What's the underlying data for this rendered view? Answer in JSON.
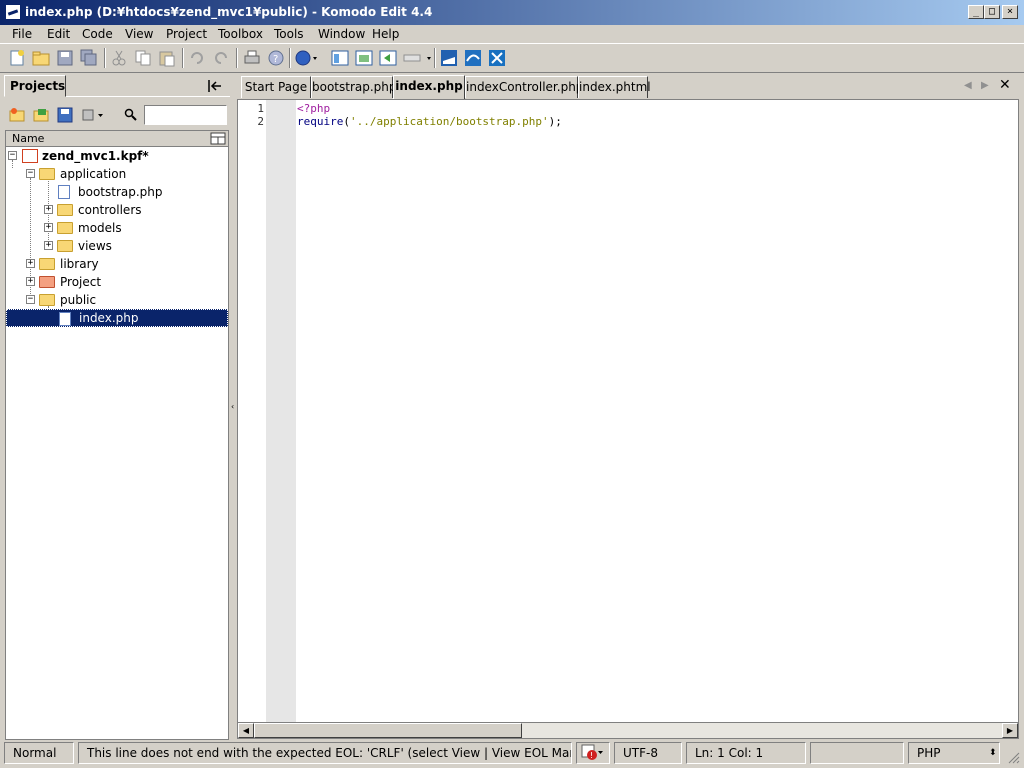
{
  "window": {
    "title": "index.php (D:¥htdocs¥zend_mvc1¥public) - Komodo Edit 4.4",
    "minimize": "_",
    "maximize": "□",
    "close": "×"
  },
  "menu": [
    "File",
    "Edit",
    "Code",
    "View",
    "Project",
    "Toolbox",
    "Tools",
    "Window",
    "Help"
  ],
  "projects_pane": {
    "tab_label": "Projects",
    "column_header": "Name",
    "tree": [
      {
        "label": "zend_mvc1.kpf*",
        "bold": true
      },
      {
        "label": "application"
      },
      {
        "label": "bootstrap.php"
      },
      {
        "label": "controllers"
      },
      {
        "label": "models"
      },
      {
        "label": "views"
      },
      {
        "label": "library"
      },
      {
        "label": "Project"
      },
      {
        "label": "public"
      },
      {
        "label": "index.php",
        "selected": true
      }
    ]
  },
  "editor": {
    "tabs": [
      "Start Page",
      "bootstrap.php",
      "index.php",
      "indexController.php",
      "index.phtml"
    ],
    "active_tab": "index.php",
    "lines": [
      {
        "num": "1",
        "text": "<?php"
      },
      {
        "num": "2",
        "text": "require('../application/bootstrap.php');"
      }
    ]
  },
  "statusbar": {
    "mode": "Normal",
    "message": "This line does not end with the expected EOL: 'CRLF' (select View | View EOL Markers)",
    "encoding": "UTF-8",
    "position": "Ln: 1 Col: 1",
    "language": "PHP"
  },
  "colors": {
    "titlebar_start": "#0a246a",
    "titlebar_end": "#a6caf0",
    "selection": "#0a246a",
    "php_tag": "#a020a0",
    "php_function": "#000080",
    "php_string": "#808000"
  }
}
